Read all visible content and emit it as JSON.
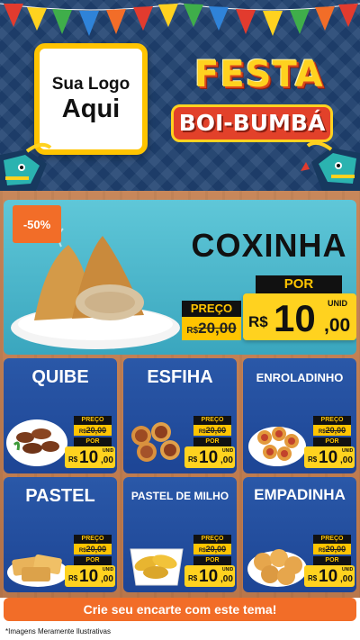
{
  "header": {
    "logo_line1": "Sua Logo",
    "logo_line2": "Aqui",
    "title_line1": "FESTA",
    "title_line2": "BOI-BUMBÁ"
  },
  "featured": {
    "discount": "-50%",
    "name": "COXINHA",
    "preco_label": "PREÇO",
    "old_currency": "R$",
    "old_value": "20,00",
    "por_label": "POR",
    "currency": "R$",
    "price_int": "10",
    "price_dec": ",00",
    "unit": "UNID"
  },
  "products": [
    {
      "name": "QUIBE",
      "preco_label": "PREÇO",
      "old_currency": "R$",
      "old_value": "20,00",
      "por_label": "POR",
      "currency": "R$",
      "price_int": "10",
      "price_dec": ",00",
      "unit": "UNID"
    },
    {
      "name": "ESFIHA",
      "preco_label": "PREÇO",
      "old_currency": "R$",
      "old_value": "20,00",
      "por_label": "POR",
      "currency": "R$",
      "price_int": "10",
      "price_dec": ",00",
      "unit": "UNID"
    },
    {
      "name": "ENROLADINHO",
      "preco_label": "PREÇO",
      "old_currency": "R$",
      "old_value": "20,00",
      "por_label": "POR",
      "currency": "R$",
      "price_int": "10",
      "price_dec": ",00",
      "unit": "UNID"
    },
    {
      "name": "PASTEL",
      "preco_label": "PREÇO",
      "old_currency": "R$",
      "old_value": "20,00",
      "por_label": "POR",
      "currency": "R$",
      "price_int": "10",
      "price_dec": ",00",
      "unit": "UNID"
    },
    {
      "name": "PASTEL DE MILHO",
      "preco_label": "PREÇO",
      "old_currency": "R$",
      "old_value": "20,00",
      "por_label": "POR",
      "currency": "R$",
      "price_int": "10",
      "price_dec": ",00",
      "unit": "UNID"
    },
    {
      "name": "EMPADINHA",
      "preco_label": "PREÇO",
      "old_currency": "R$",
      "old_value": "20,00",
      "por_label": "POR",
      "currency": "R$",
      "price_int": "10",
      "price_dec": ",00",
      "unit": "UNID"
    }
  ],
  "cta": "Crie seu encarte com este tema!",
  "disclaimer": "*Imagens Meramente Ilustrativas",
  "colors": {
    "header_bg": "#1f4170",
    "wood": "#c8875a",
    "featured_bg": "#3aa6be",
    "card_bg": "#1d4595",
    "price_yellow": "#ffd21f",
    "accent_orange": "#f26d28"
  }
}
